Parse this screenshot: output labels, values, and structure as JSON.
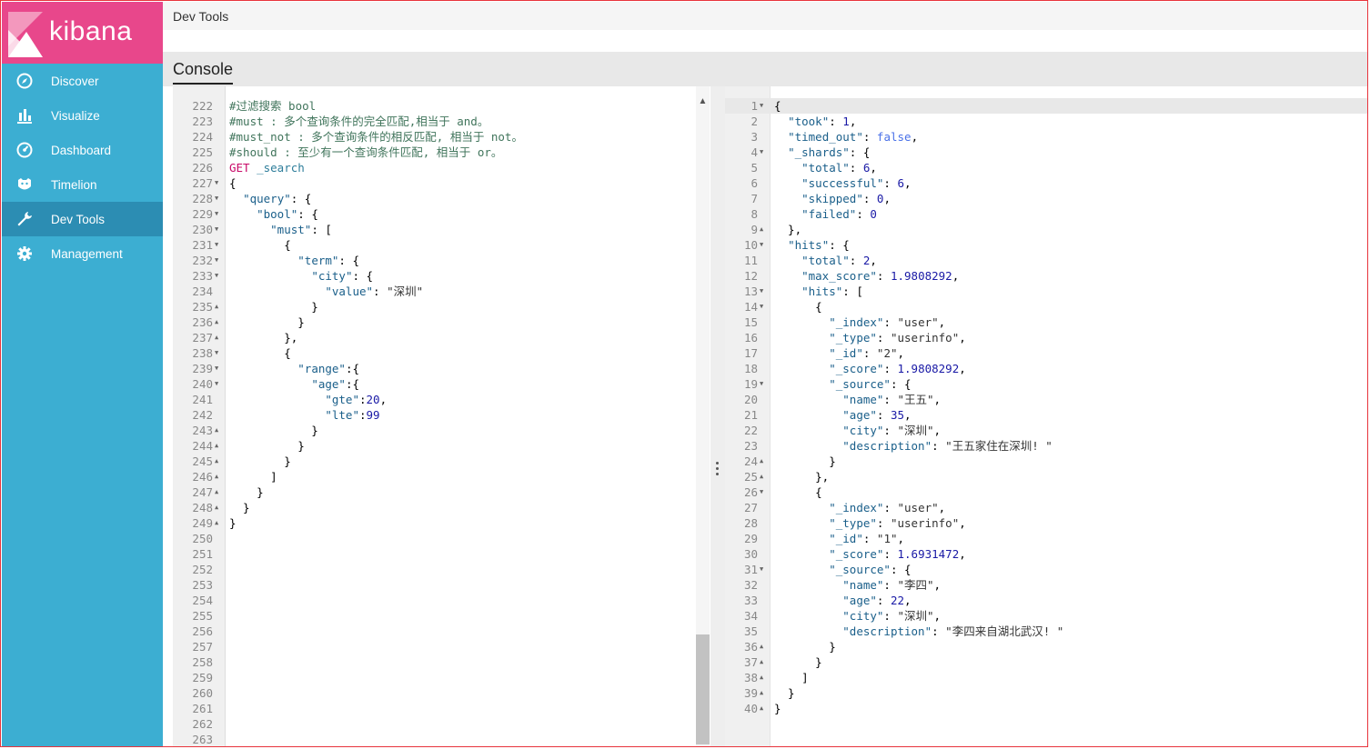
{
  "brand": {
    "name": "kibana"
  },
  "nav": [
    {
      "label": "Discover",
      "icon": "compass-icon"
    },
    {
      "label": "Visualize",
      "icon": "bar-chart-icon"
    },
    {
      "label": "Dashboard",
      "icon": "dashboard-icon"
    },
    {
      "label": "Timelion",
      "icon": "timelion-icon"
    },
    {
      "label": "Dev Tools",
      "icon": "wrench-icon",
      "active": true
    },
    {
      "label": "Management",
      "icon": "gear-icon"
    }
  ],
  "header": {
    "title": "Dev Tools"
  },
  "tabs": [
    {
      "label": "Console",
      "active": true
    }
  ],
  "request": [
    {
      "n": "222",
      "f": "",
      "t": [
        [
          "c",
          "#过滤搜索 bool"
        ]
      ]
    },
    {
      "n": "223",
      "f": "",
      "t": [
        [
          "c",
          "#must : 多个查询条件的完全匹配,相当于 and。"
        ]
      ]
    },
    {
      "n": "224",
      "f": "",
      "t": [
        [
          "c",
          "#must_not : 多个查询条件的相反匹配, 相当于 not。"
        ]
      ]
    },
    {
      "n": "225",
      "f": "",
      "t": [
        [
          "c",
          "#should : 至少有一个查询条件匹配, 相当于 or。"
        ]
      ]
    },
    {
      "n": "226",
      "f": "",
      "t": [
        [
          "m",
          "GET"
        ],
        [
          "p",
          " "
        ],
        [
          "u",
          "_search"
        ]
      ]
    },
    {
      "n": "227",
      "f": "▼",
      "t": [
        [
          "p",
          "{"
        ]
      ]
    },
    {
      "n": "228",
      "f": "▼",
      "t": [
        [
          "p",
          "  "
        ],
        [
          "k",
          "\"query\""
        ],
        [
          "p",
          ": {"
        ]
      ]
    },
    {
      "n": "229",
      "f": "▼",
      "t": [
        [
          "p",
          "    "
        ],
        [
          "k",
          "\"bool\""
        ],
        [
          "p",
          ": {"
        ]
      ]
    },
    {
      "n": "230",
      "f": "▼",
      "t": [
        [
          "p",
          "      "
        ],
        [
          "k",
          "\"must\""
        ],
        [
          "p",
          ": ["
        ]
      ]
    },
    {
      "n": "231",
      "f": "▼",
      "t": [
        [
          "p",
          "        {"
        ]
      ]
    },
    {
      "n": "232",
      "f": "▼",
      "t": [
        [
          "p",
          "          "
        ],
        [
          "k",
          "\"term\""
        ],
        [
          "p",
          ": {"
        ]
      ]
    },
    {
      "n": "233",
      "f": "▼",
      "t": [
        [
          "p",
          "            "
        ],
        [
          "k",
          "\"city\""
        ],
        [
          "p",
          ": {"
        ]
      ]
    },
    {
      "n": "234",
      "f": "",
      "t": [
        [
          "p",
          "              "
        ],
        [
          "k",
          "\"value\""
        ],
        [
          "p",
          ": "
        ],
        [
          "s",
          "\"深圳\""
        ]
      ]
    },
    {
      "n": "235",
      "f": "▲",
      "t": [
        [
          "p",
          "            }"
        ]
      ]
    },
    {
      "n": "236",
      "f": "▲",
      "t": [
        [
          "p",
          "          }"
        ]
      ]
    },
    {
      "n": "237",
      "f": "▲",
      "t": [
        [
          "p",
          "        },"
        ]
      ]
    },
    {
      "n": "238",
      "f": "▼",
      "t": [
        [
          "p",
          "        {"
        ]
      ]
    },
    {
      "n": "239",
      "f": "▼",
      "t": [
        [
          "p",
          "          "
        ],
        [
          "k",
          "\"range\""
        ],
        [
          "p",
          ":{"
        ]
      ]
    },
    {
      "n": "240",
      "f": "▼",
      "t": [
        [
          "p",
          "            "
        ],
        [
          "k",
          "\"age\""
        ],
        [
          "p",
          ":{"
        ]
      ]
    },
    {
      "n": "241",
      "f": "",
      "t": [
        [
          "p",
          "              "
        ],
        [
          "k",
          "\"gte\""
        ],
        [
          "p",
          ":"
        ],
        [
          "d",
          "20"
        ],
        [
          "p",
          ","
        ]
      ]
    },
    {
      "n": "242",
      "f": "",
      "t": [
        [
          "p",
          "              "
        ],
        [
          "k",
          "\"lte\""
        ],
        [
          "p",
          ":"
        ],
        [
          "d",
          "99"
        ]
      ]
    },
    {
      "n": "243",
      "f": "▲",
      "t": [
        [
          "p",
          "            }"
        ]
      ]
    },
    {
      "n": "244",
      "f": "▲",
      "t": [
        [
          "p",
          "          }"
        ]
      ]
    },
    {
      "n": "245",
      "f": "▲",
      "t": [
        [
          "p",
          "        }"
        ]
      ]
    },
    {
      "n": "246",
      "f": "▲",
      "t": [
        [
          "p",
          "      ]"
        ]
      ]
    },
    {
      "n": "247",
      "f": "▲",
      "t": [
        [
          "p",
          "    }"
        ]
      ]
    },
    {
      "n": "248",
      "f": "▲",
      "t": [
        [
          "p",
          "  }"
        ]
      ]
    },
    {
      "n": "249",
      "f": "▲",
      "t": [
        [
          "p",
          "}"
        ]
      ]
    },
    {
      "n": "250",
      "f": "",
      "t": []
    },
    {
      "n": "251",
      "f": "",
      "t": []
    },
    {
      "n": "252",
      "f": "",
      "t": []
    },
    {
      "n": "253",
      "f": "",
      "t": []
    },
    {
      "n": "254",
      "f": "",
      "t": []
    },
    {
      "n": "255",
      "f": "",
      "t": []
    },
    {
      "n": "256",
      "f": "",
      "t": []
    },
    {
      "n": "257",
      "f": "",
      "t": []
    },
    {
      "n": "258",
      "f": "",
      "t": []
    },
    {
      "n": "259",
      "f": "",
      "t": []
    },
    {
      "n": "260",
      "f": "",
      "t": []
    },
    {
      "n": "261",
      "f": "",
      "t": []
    },
    {
      "n": "262",
      "f": "",
      "t": []
    },
    {
      "n": "263",
      "f": "",
      "t": []
    }
  ],
  "response": [
    {
      "n": "1",
      "f": "▼",
      "t": [
        [
          "p",
          "{"
        ]
      ],
      "hl": true
    },
    {
      "n": "2",
      "f": "",
      "t": [
        [
          "p",
          "  "
        ],
        [
          "k",
          "\"took\""
        ],
        [
          "p",
          ": "
        ],
        [
          "d",
          "1"
        ],
        [
          "p",
          ","
        ]
      ]
    },
    {
      "n": "3",
      "f": "",
      "t": [
        [
          "p",
          "  "
        ],
        [
          "k",
          "\"timed_out\""
        ],
        [
          "p",
          ": "
        ],
        [
          "b",
          "false"
        ],
        [
          "p",
          ","
        ]
      ]
    },
    {
      "n": "4",
      "f": "▼",
      "t": [
        [
          "p",
          "  "
        ],
        [
          "k",
          "\"_shards\""
        ],
        [
          "p",
          ": {"
        ]
      ]
    },
    {
      "n": "5",
      "f": "",
      "t": [
        [
          "p",
          "    "
        ],
        [
          "k",
          "\"total\""
        ],
        [
          "p",
          ": "
        ],
        [
          "d",
          "6"
        ],
        [
          "p",
          ","
        ]
      ]
    },
    {
      "n": "6",
      "f": "",
      "t": [
        [
          "p",
          "    "
        ],
        [
          "k",
          "\"successful\""
        ],
        [
          "p",
          ": "
        ],
        [
          "d",
          "6"
        ],
        [
          "p",
          ","
        ]
      ]
    },
    {
      "n": "7",
      "f": "",
      "t": [
        [
          "p",
          "    "
        ],
        [
          "k",
          "\"skipped\""
        ],
        [
          "p",
          ": "
        ],
        [
          "d",
          "0"
        ],
        [
          "p",
          ","
        ]
      ]
    },
    {
      "n": "8",
      "f": "",
      "t": [
        [
          "p",
          "    "
        ],
        [
          "k",
          "\"failed\""
        ],
        [
          "p",
          ": "
        ],
        [
          "d",
          "0"
        ]
      ]
    },
    {
      "n": "9",
      "f": "▲",
      "t": [
        [
          "p",
          "  },"
        ]
      ]
    },
    {
      "n": "10",
      "f": "▼",
      "t": [
        [
          "p",
          "  "
        ],
        [
          "k",
          "\"hits\""
        ],
        [
          "p",
          ": {"
        ]
      ]
    },
    {
      "n": "11",
      "f": "",
      "t": [
        [
          "p",
          "    "
        ],
        [
          "k",
          "\"total\""
        ],
        [
          "p",
          ": "
        ],
        [
          "d",
          "2"
        ],
        [
          "p",
          ","
        ]
      ]
    },
    {
      "n": "12",
      "f": "",
      "t": [
        [
          "p",
          "    "
        ],
        [
          "k",
          "\"max_score\""
        ],
        [
          "p",
          ": "
        ],
        [
          "d",
          "1.9808292"
        ],
        [
          "p",
          ","
        ]
      ]
    },
    {
      "n": "13",
      "f": "▼",
      "t": [
        [
          "p",
          "    "
        ],
        [
          "k",
          "\"hits\""
        ],
        [
          "p",
          ": ["
        ]
      ]
    },
    {
      "n": "14",
      "f": "▼",
      "t": [
        [
          "p",
          "      {"
        ]
      ]
    },
    {
      "n": "15",
      "f": "",
      "t": [
        [
          "p",
          "        "
        ],
        [
          "k",
          "\"_index\""
        ],
        [
          "p",
          ": "
        ],
        [
          "s",
          "\"user\""
        ],
        [
          "p",
          ","
        ]
      ]
    },
    {
      "n": "16",
      "f": "",
      "t": [
        [
          "p",
          "        "
        ],
        [
          "k",
          "\"_type\""
        ],
        [
          "p",
          ": "
        ],
        [
          "s",
          "\"userinfo\""
        ],
        [
          "p",
          ","
        ]
      ]
    },
    {
      "n": "17",
      "f": "",
      "t": [
        [
          "p",
          "        "
        ],
        [
          "k",
          "\"_id\""
        ],
        [
          "p",
          ": "
        ],
        [
          "s",
          "\"2\""
        ],
        [
          "p",
          ","
        ]
      ]
    },
    {
      "n": "18",
      "f": "",
      "t": [
        [
          "p",
          "        "
        ],
        [
          "k",
          "\"_score\""
        ],
        [
          "p",
          ": "
        ],
        [
          "d",
          "1.9808292"
        ],
        [
          "p",
          ","
        ]
      ]
    },
    {
      "n": "19",
      "f": "▼",
      "t": [
        [
          "p",
          "        "
        ],
        [
          "k",
          "\"_source\""
        ],
        [
          "p",
          ": {"
        ]
      ]
    },
    {
      "n": "20",
      "f": "",
      "t": [
        [
          "p",
          "          "
        ],
        [
          "k",
          "\"name\""
        ],
        [
          "p",
          ": "
        ],
        [
          "s",
          "\"王五\""
        ],
        [
          "p",
          ","
        ]
      ]
    },
    {
      "n": "21",
      "f": "",
      "t": [
        [
          "p",
          "          "
        ],
        [
          "k",
          "\"age\""
        ],
        [
          "p",
          ": "
        ],
        [
          "d",
          "35"
        ],
        [
          "p",
          ","
        ]
      ]
    },
    {
      "n": "22",
      "f": "",
      "t": [
        [
          "p",
          "          "
        ],
        [
          "k",
          "\"city\""
        ],
        [
          "p",
          ": "
        ],
        [
          "s",
          "\"深圳\""
        ],
        [
          "p",
          ","
        ]
      ]
    },
    {
      "n": "23",
      "f": "",
      "t": [
        [
          "p",
          "          "
        ],
        [
          "k",
          "\"description\""
        ],
        [
          "p",
          ": "
        ],
        [
          "s",
          "\"王五家住在深圳! \""
        ]
      ]
    },
    {
      "n": "24",
      "f": "▲",
      "t": [
        [
          "p",
          "        }"
        ]
      ]
    },
    {
      "n": "25",
      "f": "▲",
      "t": [
        [
          "p",
          "      },"
        ]
      ]
    },
    {
      "n": "26",
      "f": "▼",
      "t": [
        [
          "p",
          "      {"
        ]
      ]
    },
    {
      "n": "27",
      "f": "",
      "t": [
        [
          "p",
          "        "
        ],
        [
          "k",
          "\"_index\""
        ],
        [
          "p",
          ": "
        ],
        [
          "s",
          "\"user\""
        ],
        [
          "p",
          ","
        ]
      ]
    },
    {
      "n": "28",
      "f": "",
      "t": [
        [
          "p",
          "        "
        ],
        [
          "k",
          "\"_type\""
        ],
        [
          "p",
          ": "
        ],
        [
          "s",
          "\"userinfo\""
        ],
        [
          "p",
          ","
        ]
      ]
    },
    {
      "n": "29",
      "f": "",
      "t": [
        [
          "p",
          "        "
        ],
        [
          "k",
          "\"_id\""
        ],
        [
          "p",
          ": "
        ],
        [
          "s",
          "\"1\""
        ],
        [
          "p",
          ","
        ]
      ]
    },
    {
      "n": "30",
      "f": "",
      "t": [
        [
          "p",
          "        "
        ],
        [
          "k",
          "\"_score\""
        ],
        [
          "p",
          ": "
        ],
        [
          "d",
          "1.6931472"
        ],
        [
          "p",
          ","
        ]
      ]
    },
    {
      "n": "31",
      "f": "▼",
      "t": [
        [
          "p",
          "        "
        ],
        [
          "k",
          "\"_source\""
        ],
        [
          "p",
          ": {"
        ]
      ]
    },
    {
      "n": "32",
      "f": "",
      "t": [
        [
          "p",
          "          "
        ],
        [
          "k",
          "\"name\""
        ],
        [
          "p",
          ": "
        ],
        [
          "s",
          "\"李四\""
        ],
        [
          "p",
          ","
        ]
      ]
    },
    {
      "n": "33",
      "f": "",
      "t": [
        [
          "p",
          "          "
        ],
        [
          "k",
          "\"age\""
        ],
        [
          "p",
          ": "
        ],
        [
          "d",
          "22"
        ],
        [
          "p",
          ","
        ]
      ]
    },
    {
      "n": "34",
      "f": "",
      "t": [
        [
          "p",
          "          "
        ],
        [
          "k",
          "\"city\""
        ],
        [
          "p",
          ": "
        ],
        [
          "s",
          "\"深圳\""
        ],
        [
          "p",
          ","
        ]
      ]
    },
    {
      "n": "35",
      "f": "",
      "t": [
        [
          "p",
          "          "
        ],
        [
          "k",
          "\"description\""
        ],
        [
          "p",
          ": "
        ],
        [
          "s",
          "\"李四来自湖北武汉! \""
        ]
      ]
    },
    {
      "n": "36",
      "f": "▲",
      "t": [
        [
          "p",
          "        }"
        ]
      ]
    },
    {
      "n": "37",
      "f": "▲",
      "t": [
        [
          "p",
          "      }"
        ]
      ]
    },
    {
      "n": "38",
      "f": "▲",
      "t": [
        [
          "p",
          "    ]"
        ]
      ]
    },
    {
      "n": "39",
      "f": "▲",
      "t": [
        [
          "p",
          "  }"
        ]
      ]
    },
    {
      "n": "40",
      "f": "▲",
      "t": [
        [
          "p",
          "}"
        ]
      ]
    }
  ]
}
